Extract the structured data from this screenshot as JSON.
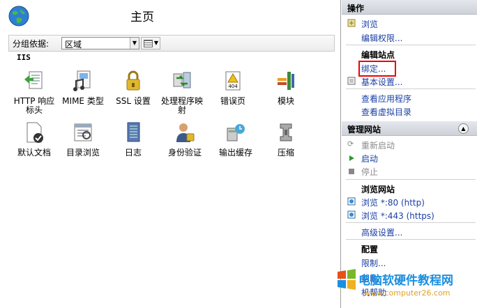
{
  "header": {
    "title": "主页"
  },
  "group_by": {
    "label": "分组依据:",
    "value": "区域"
  },
  "section": "IIS",
  "features": [
    {
      "label": "HTTP 响应标头",
      "icon": "http-response-headers-icon"
    },
    {
      "label": "MIME 类型",
      "icon": "mime-types-icon"
    },
    {
      "label": "SSL 设置",
      "icon": "ssl-lock-icon"
    },
    {
      "label": "处理程序映射",
      "icon": "handler-mappings-icon"
    },
    {
      "label": "错误页",
      "icon": "error-pages-icon"
    },
    {
      "label": "模块",
      "icon": "modules-icon"
    },
    {
      "label": "默认文档",
      "icon": "default-document-icon"
    },
    {
      "label": "目录浏览",
      "icon": "directory-browsing-icon"
    },
    {
      "label": "日志",
      "icon": "logging-icon"
    },
    {
      "label": "身份验证",
      "icon": "authentication-icon"
    },
    {
      "label": "输出缓存",
      "icon": "output-caching-icon"
    },
    {
      "label": "压缩",
      "icon": "compression-icon"
    }
  ],
  "actions": {
    "title": "操作",
    "browse": "浏览",
    "edit_permissions": "编辑权限...",
    "edit_site_group": "编辑站点",
    "bindings": "绑定...",
    "basic_settings": "基本设置...",
    "view_applications": "查看应用程序",
    "view_virtual_dirs": "查看虚拟目录",
    "manage_site": "管理网站",
    "restart": "重新启动",
    "start": "启动",
    "stop": "停止",
    "browse_site_group": "浏览网站",
    "browse_80": "浏览 *:80 (http)",
    "browse_443": "浏览 *:443 (https)",
    "advanced_settings": "高级设置...",
    "configure_group": "配置",
    "limits": "限制...",
    "help": "帮助",
    "online_help": "机帮助"
  },
  "watermark": {
    "text": "电脑软硬件教程网",
    "url": "www.computer26.com"
  },
  "colors": {
    "link": "#1a3fa5",
    "highlight": "#e00000",
    "header_bg": "#cdd2d9"
  }
}
